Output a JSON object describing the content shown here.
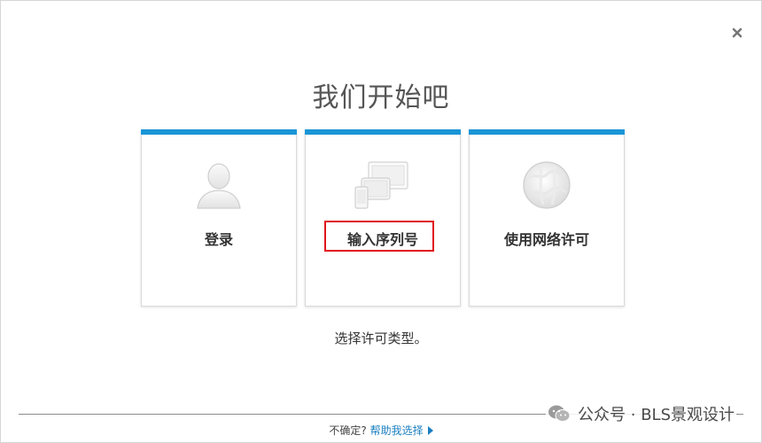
{
  "dialog": {
    "title": "我们开始吧",
    "close_icon": "close-icon"
  },
  "cards": [
    {
      "label": "登录",
      "icon": "user-silhouette-icon"
    },
    {
      "label": "输入序列号",
      "icon": "devices-icon",
      "highlighted": true
    },
    {
      "label": "使用网络许可",
      "icon": "globe-network-icon"
    }
  ],
  "colors": {
    "accent": "#1a95d6",
    "highlight": "#e0101c",
    "link": "#1a7fc1"
  },
  "subtitle": "选择许可类型。",
  "footer": {
    "question": "不确定?",
    "help_link": "帮助我选择"
  },
  "watermark": {
    "text": "公众号 · BLS景观设计"
  }
}
